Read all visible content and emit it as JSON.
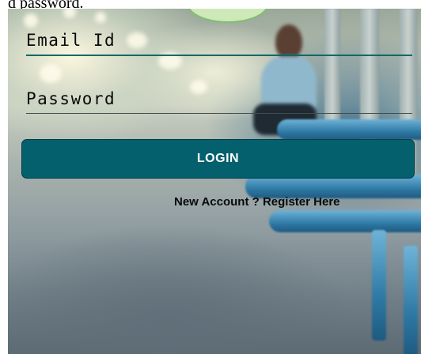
{
  "caption": {
    "text": "d password."
  },
  "form": {
    "email": {
      "placeholder": "Email Id",
      "value": ""
    },
    "password": {
      "placeholder": "Password",
      "value": ""
    },
    "login_label": "LOGIN",
    "register_label": "New Account ? Register Here"
  },
  "colors": {
    "login_button": "#04606d",
    "email_underline": "#0b6b67",
    "text": "#0b0b0b"
  }
}
